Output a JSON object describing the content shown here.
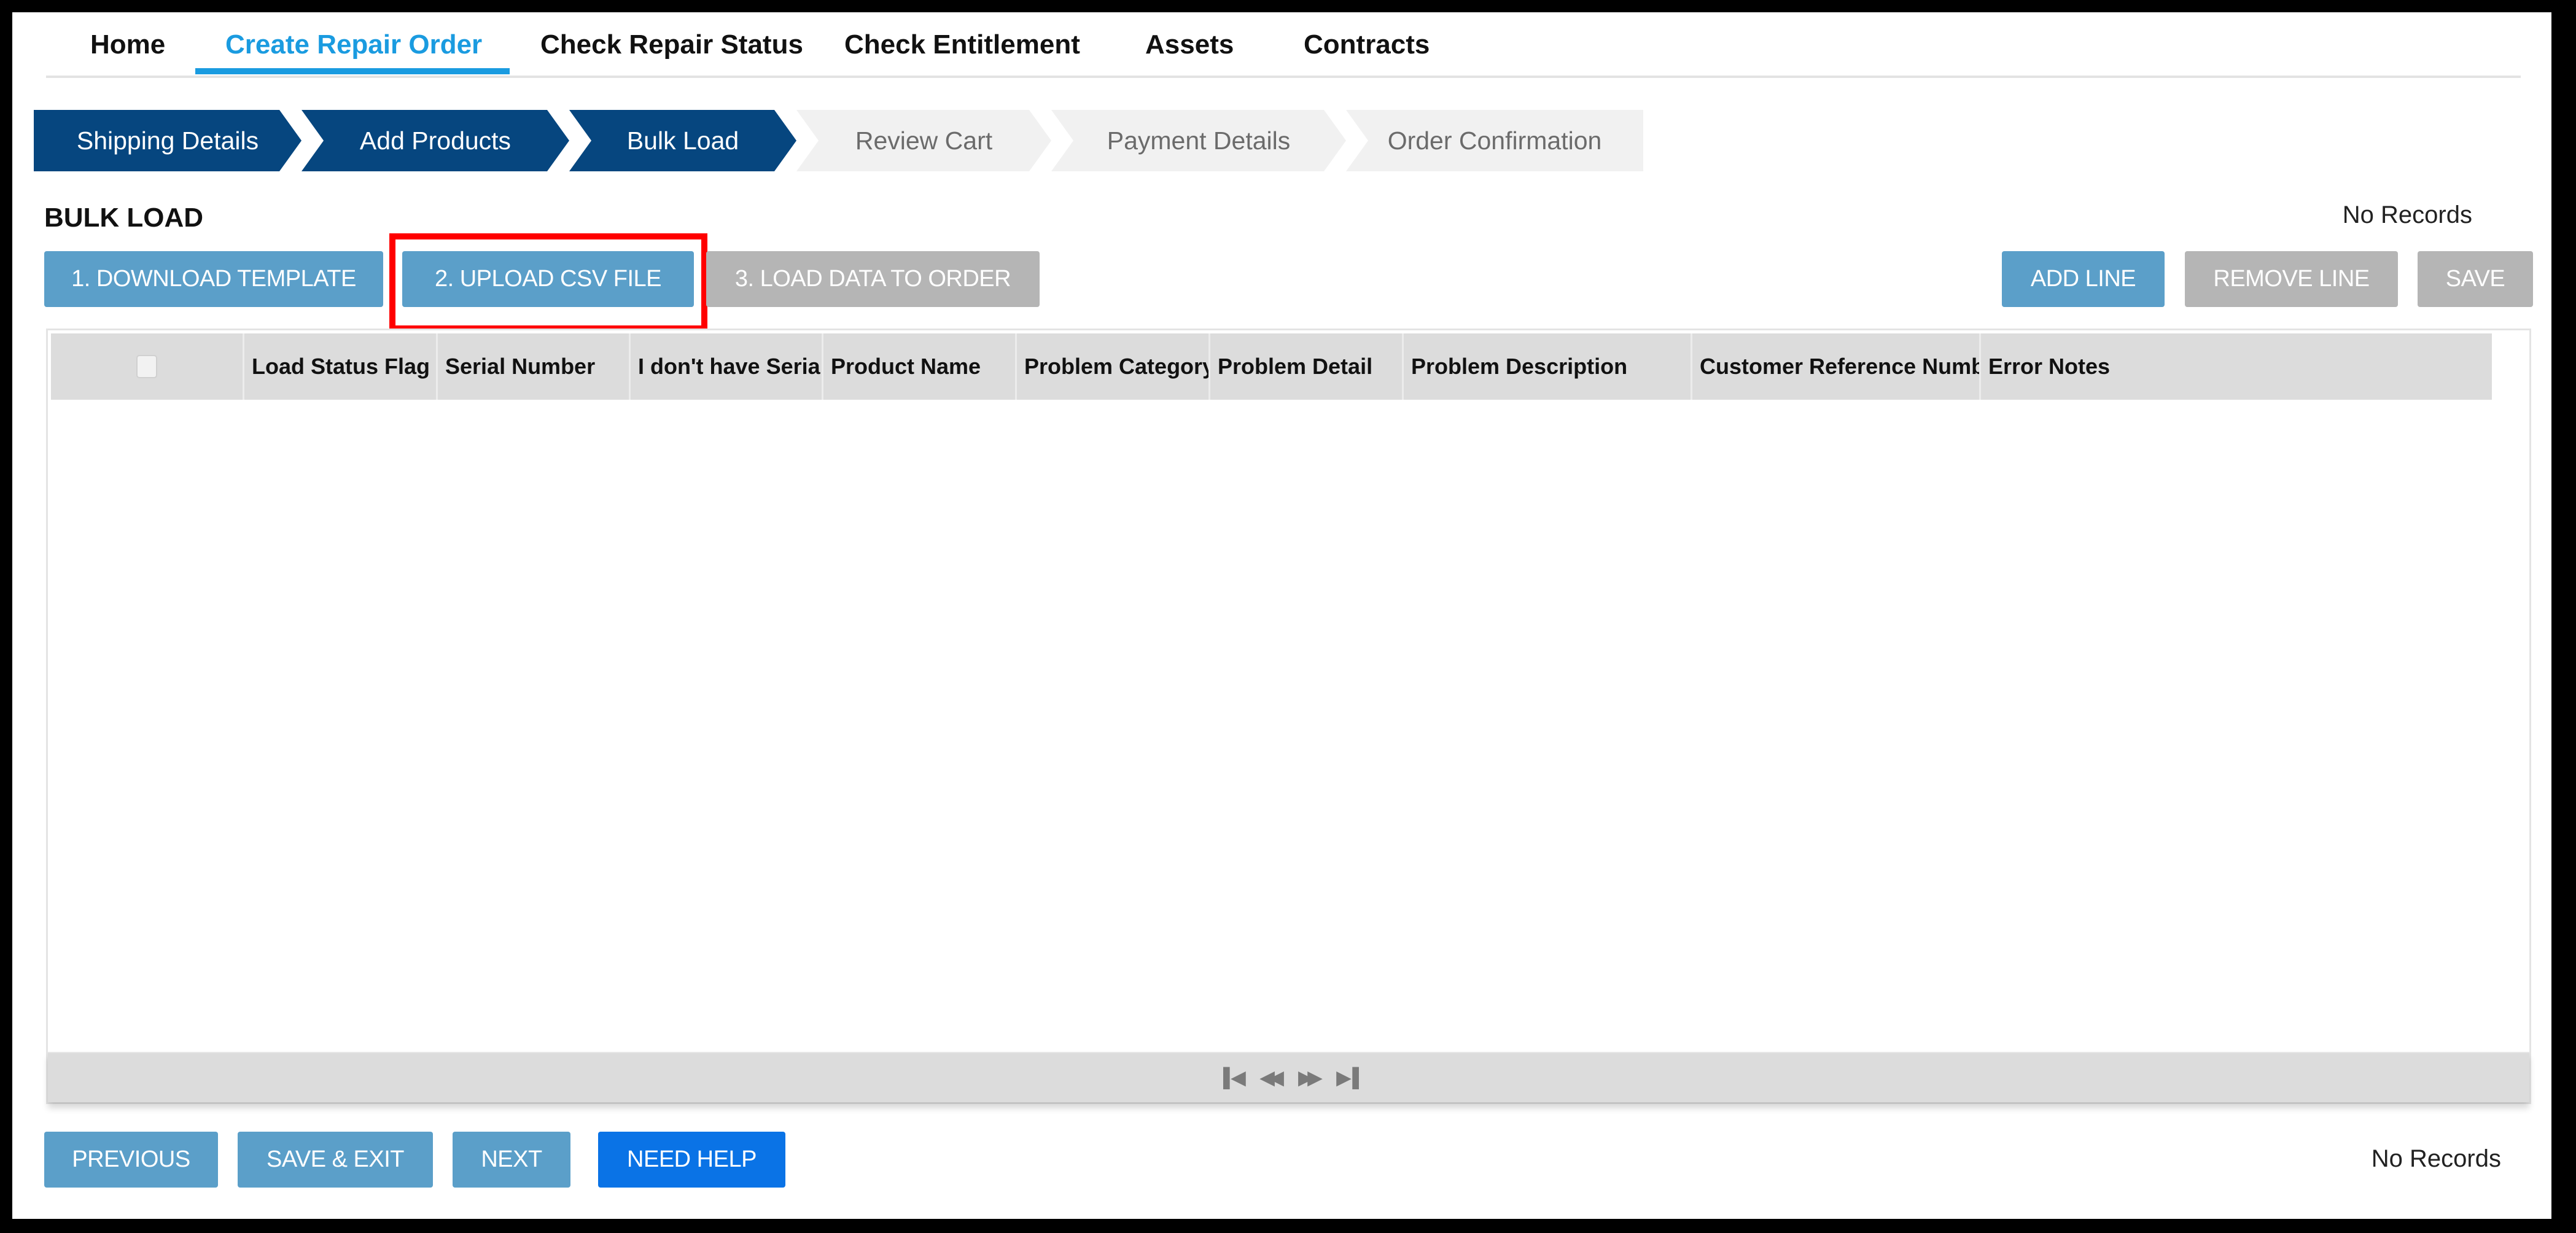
{
  "nav": {
    "items": [
      {
        "label": "Home",
        "active": false
      },
      {
        "label": "Create Repair Order",
        "active": true
      },
      {
        "label": "Check Repair Status",
        "active": false
      },
      {
        "label": "Check Entitlement",
        "active": false
      },
      {
        "label": "Assets",
        "active": false
      },
      {
        "label": "Contracts",
        "active": false
      }
    ]
  },
  "steps": [
    {
      "label": "Shipping Details",
      "status": "completed"
    },
    {
      "label": "Add Products",
      "status": "completed"
    },
    {
      "label": "Bulk Load",
      "status": "current"
    },
    {
      "label": "Review Cart",
      "status": "pending"
    },
    {
      "label": "Payment Details",
      "status": "pending"
    },
    {
      "label": "Order Confirmation",
      "status": "pending"
    }
  ],
  "section": {
    "title": "BULK LOAD",
    "records_top": "No Records",
    "records_bottom": "No Records"
  },
  "toolbar": {
    "download_template": "1. DOWNLOAD TEMPLATE",
    "upload_csv": "2. UPLOAD CSV FILE",
    "load_data": "3. LOAD DATA TO ORDER",
    "add_line": "ADD LINE",
    "remove_line": "REMOVE LINE",
    "save": "SAVE"
  },
  "grid": {
    "columns": [
      "Load Status Flag",
      "Serial Number",
      "I don't have Serial",
      "Product Name",
      "Problem Category",
      "Problem Detail",
      "Problem Description",
      "Customer Reference Numbe",
      "Error Notes"
    ],
    "rows": [],
    "pager": {
      "first": "first-page-icon",
      "prev": "previous-page-icon",
      "next": "next-page-icon",
      "last": "last-page-icon"
    }
  },
  "footer": {
    "previous": "PREVIOUS",
    "save_exit": "SAVE & EXIT",
    "next": "NEXT",
    "need_help": "NEED HELP"
  },
  "colors": {
    "nav_active": "#1a9be0",
    "step_done": "#06467f",
    "step_pending": "#f1f1f1",
    "button_primary": "#5b9fc9",
    "button_disabled": "#b5b5b5",
    "button_help": "#0a73e6",
    "highlight": "#ff0000"
  }
}
